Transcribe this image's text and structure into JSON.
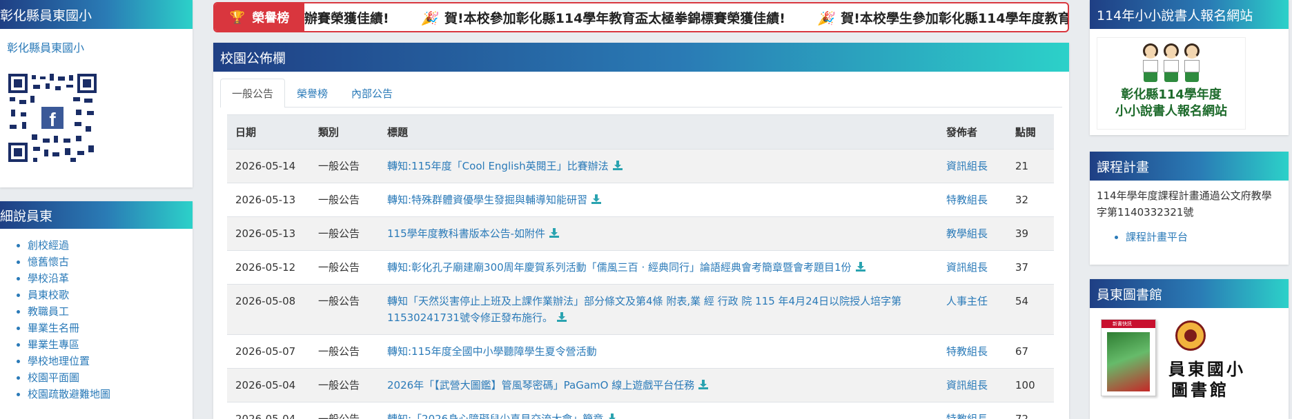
{
  "left": {
    "school_panel": {
      "title": "彰化縣員東國小",
      "link_label": "彰化縣員東國小"
    },
    "about_panel": {
      "title": "細說員東",
      "items": [
        "創校經過",
        "憶舊懷古",
        "學校沿革",
        "員東校歌",
        "教職員工",
        "畢業生名冊",
        "畢業生專區",
        "學校地理位置",
        "校園平面圖",
        "校園疏散避難地圖"
      ]
    }
  },
  "marquee": {
    "label": "榮譽榜",
    "trophy_icon": "trophy-icon",
    "items": [
      {
        "icon": "🎉",
        "text": "辦賽榮獲佳績!",
        "partial_prefix": true
      },
      {
        "icon": "🎉",
        "text": "賀!本校參加彰化縣114學年教育盃太極拳錦標賽榮獲佳績!"
      },
      {
        "icon": "🎉",
        "text": "賀!本校學生參加彰化縣114學年度教育盃"
      }
    ]
  },
  "board": {
    "title": "校園公佈欄",
    "tabs": [
      {
        "label": "一般公告",
        "active": true
      },
      {
        "label": "榮譽榜",
        "active": false
      },
      {
        "label": "內部公告",
        "active": false
      }
    ],
    "columns": {
      "date": "日期",
      "category": "類別",
      "title": "標題",
      "publisher": "發佈者",
      "hits": "點閱"
    },
    "rows": [
      {
        "date": "2026-05-14",
        "category": "一般公告",
        "title": "轉知:115年度「Cool English英閱王」比賽辦法",
        "publisher": "資訊組長",
        "hits": "21",
        "attachment": true
      },
      {
        "date": "2026-05-13",
        "category": "一般公告",
        "title": "轉知:特殊群體資優學生發掘與輔導知能研習",
        "publisher": "特教組長",
        "hits": "32",
        "attachment": true
      },
      {
        "date": "2026-05-13",
        "category": "一般公告",
        "title": "115學年度教科書版本公告-如附件",
        "publisher": "教學組長",
        "hits": "39",
        "attachment": true
      },
      {
        "date": "2026-05-12",
        "category": "一般公告",
        "title": "轉知:彰化孔子廟建廟300周年慶賀系列活動「儒風三百 · 經典同行」論語經典會考簡章暨會考題目1份",
        "publisher": "資訊組長",
        "hits": "37",
        "attachment": true
      },
      {
        "date": "2026-05-08",
        "category": "一般公告",
        "title": "轉知「天然災害停止上班及上課作業辦法」部分條文及第4條 附表,業 經 行政 院 115 年4月24日以院授人培字第 11530241731號令修正發布施行。",
        "publisher": "人事主任",
        "hits": "54",
        "attachment": true
      },
      {
        "date": "2026-05-07",
        "category": "一般公告",
        "title": "轉知:115年度全國中小學聽障學生夏令營活動",
        "publisher": "特教組長",
        "hits": "67",
        "attachment": false
      },
      {
        "date": "2026-05-04",
        "category": "一般公告",
        "title": "2026年「【武營大圖鑑】管風琴密碼」PaGamO 線上遊戲平台任務",
        "publisher": "資訊組長",
        "hits": "100",
        "attachment": true
      },
      {
        "date": "2026-05-04",
        "category": "一般公告",
        "title": "轉知:「2026身心障礙兒少喜見交流大會」簡章",
        "publisher": "特教組長",
        "hits": "72",
        "attachment": true
      }
    ]
  },
  "right": {
    "storyteller": {
      "title": "114年小小說書人報名網站",
      "banner_line1": "彰化縣114學年度",
      "banner_line2": "小小說書人報名網站"
    },
    "curriculum": {
      "title": "課程計畫",
      "text": "114年學年度課程計畫通過公文府教學字第1140332321號",
      "link_label": "課程計畫平台"
    },
    "library": {
      "title": "員東圖書館",
      "book_label": "新書快訊",
      "name_line1": "員東國小",
      "name_line2": "圖書館"
    }
  },
  "colors": {
    "header_gradient_start": "#1f3f84",
    "header_gradient_end": "#2cd1c9",
    "marquee_red": "#d9363e",
    "link_blue": "#2a7ab8"
  }
}
